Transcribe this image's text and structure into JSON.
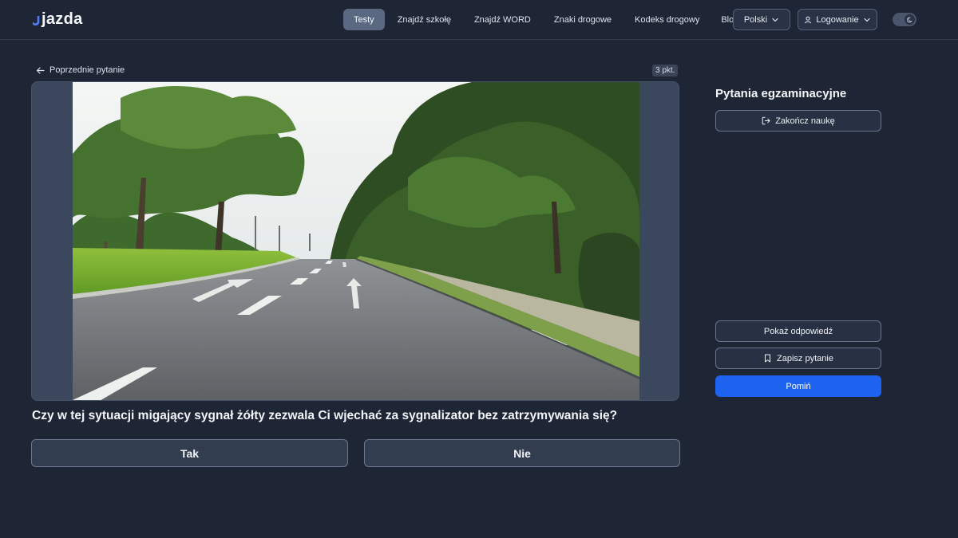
{
  "header": {
    "logo_text": "jazda",
    "nav": [
      {
        "label": "Testy",
        "active": true
      },
      {
        "label": "Znajdź szkołę",
        "active": false
      },
      {
        "label": "Znajdź WORD",
        "active": false
      },
      {
        "label": "Znaki drogowe",
        "active": false
      },
      {
        "label": "Kodeks drogowy",
        "active": false
      },
      {
        "label": "Blog",
        "active": false
      }
    ],
    "language_label": "Polski",
    "login_label": "Logowanie",
    "theme_toggle_icon": "moon-icon"
  },
  "question": {
    "prev_label": "Poprzednie pytanie",
    "points": "3 pkt.",
    "text": "Czy w tej sytuacji migający sygnał żółty zezwala Ci wjechać za sygnalizator bez zatrzymywania się?",
    "answers": {
      "yes": "Tak",
      "no": "Nie"
    }
  },
  "panel": {
    "title": "Pytania egzaminacyjne",
    "finish_label": "Zakończ naukę",
    "show_answer_label": "Pokaż odpowiedź",
    "save_label": "Zapisz pytanie",
    "skip_label": "Pomiń"
  },
  "colors": {
    "background": "#1e2535",
    "accent": "#1d63f0",
    "nav_active": "#5a6882"
  }
}
